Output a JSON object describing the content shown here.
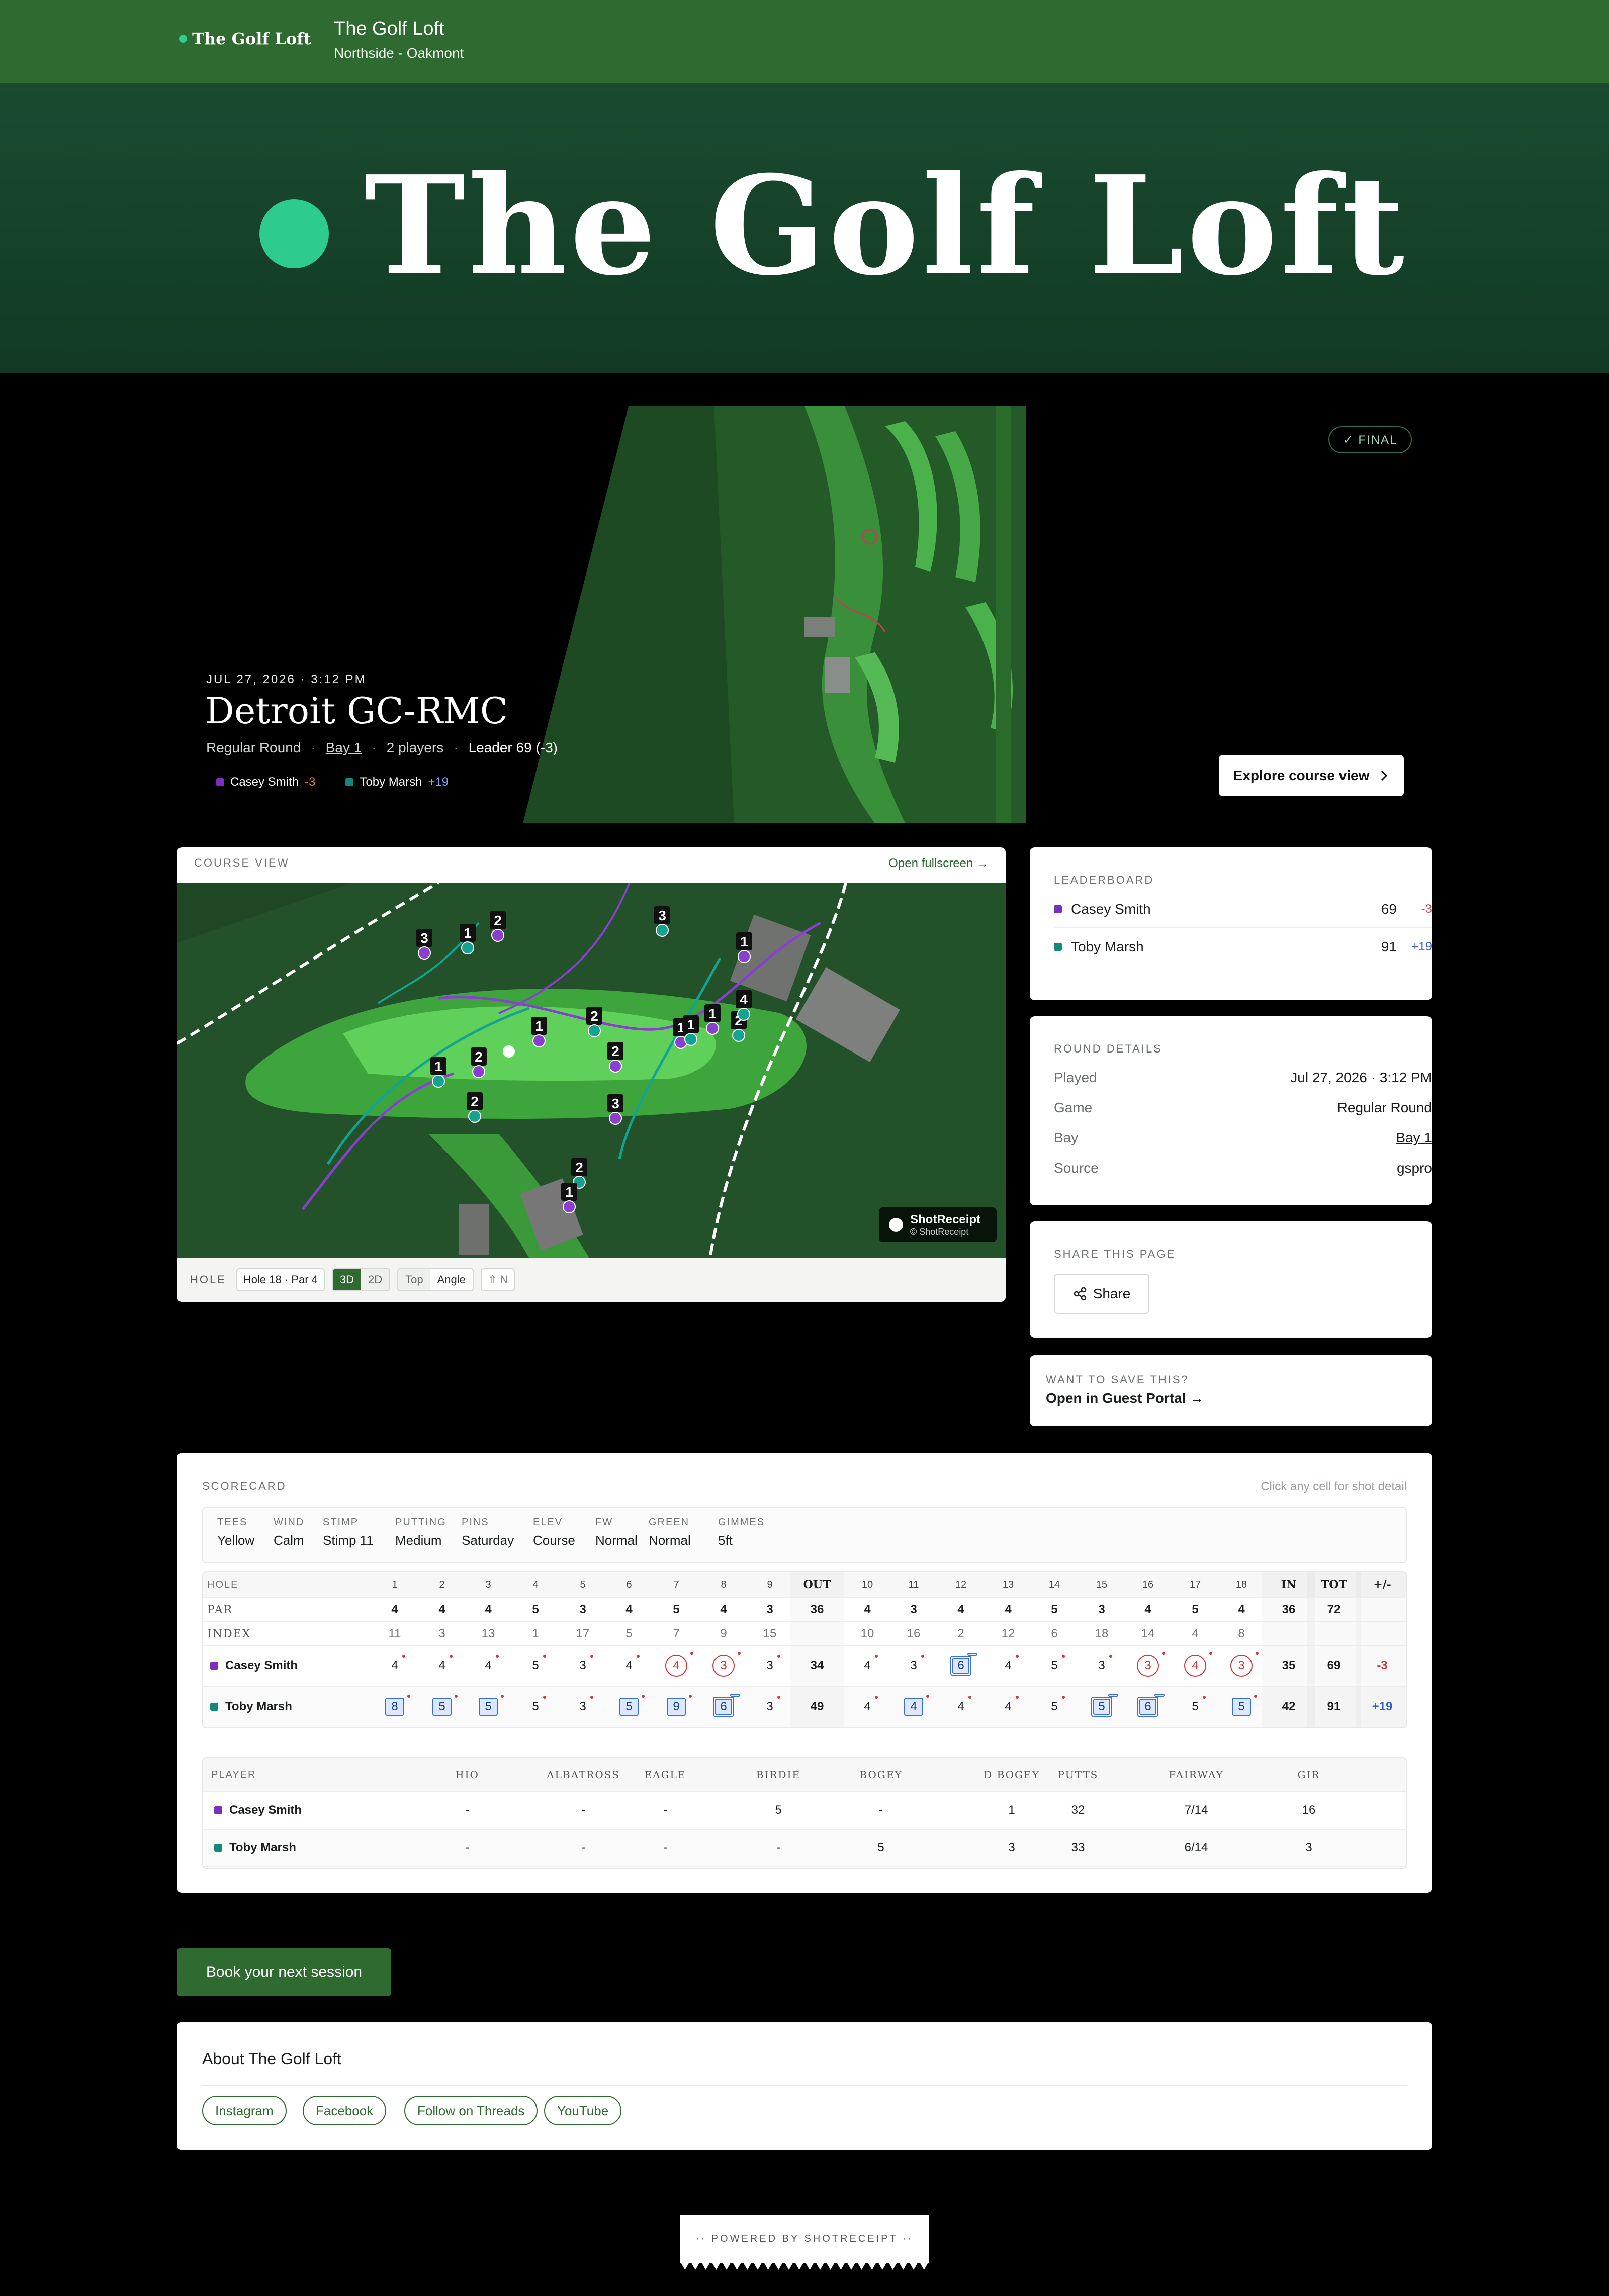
{
  "topbar": {
    "logo_text": "The Golf Loft",
    "venue_title": "The Golf Loft",
    "venue_location": "Northside - Oakmont",
    "accent_color": "#2fcb8f"
  },
  "banner": {
    "title": "The Golf Loft"
  },
  "hero": {
    "status_badge": "✓ FINAL",
    "date": "JUL 27, 2026 · 3:12 PM",
    "course": "Detroit GC-RMC",
    "game": "Regular Round",
    "bay": "Bay 1",
    "players_count": "2 players",
    "leader": "Leader 69 (-3)",
    "players": [
      {
        "name": "Casey Smith",
        "diff": "-3",
        "color": "#7b2fc1"
      },
      {
        "name": "Toby Marsh",
        "diff": "+19",
        "color": "#13897a"
      }
    ],
    "explore_label": "Explore course view",
    "separator": "·"
  },
  "course_view": {
    "label": "COURSE VIEW",
    "open_fullscreen": "Open fullscreen →",
    "brand_name": "ShotReceipt",
    "brand_copy": "© ShotReceipt",
    "hole_label": "HOLE",
    "hole_select": "Hole 18 · Par 4",
    "view_3d": "3D",
    "view_2d": "2D",
    "cam_top": "Top",
    "cam_angle": "Angle",
    "north": "⇧ N",
    "markers": [
      "3",
      "1",
      "2",
      "3",
      "1",
      "2",
      "1",
      "4",
      "1",
      "2",
      "2",
      "1",
      "2",
      "1",
      "1",
      "2",
      "3",
      "2",
      "1"
    ]
  },
  "leaderboard": {
    "label": "LEADERBOARD",
    "rows": [
      {
        "name": "Casey Smith",
        "score": "69",
        "diff": "-3"
      },
      {
        "name": "Toby Marsh",
        "score": "91",
        "diff": "+19"
      }
    ]
  },
  "round_details": {
    "label": "ROUND DETAILS",
    "rows": [
      {
        "k": "Played",
        "v": "Jul 27, 2026 · 3:12 PM"
      },
      {
        "k": "Game",
        "v": "Regular Round"
      },
      {
        "k": "Bay",
        "v": "Bay 1"
      },
      {
        "k": "Source",
        "v": "gspro"
      }
    ]
  },
  "share": {
    "label": "SHARE THIS PAGE",
    "button": "Share"
  },
  "guest": {
    "label": "WANT TO SAVE THIS?",
    "link": "Open in Guest Portal →"
  },
  "scorecard": {
    "label": "SCORECARD",
    "hint": "Click any cell for shot detail",
    "conditions": [
      {
        "k": "TEES",
        "v": "Yellow"
      },
      {
        "k": "WIND",
        "v": "Calm"
      },
      {
        "k": "STIMP",
        "v": "Stimp 11"
      },
      {
        "k": "PUTTING",
        "v": "Medium"
      },
      {
        "k": "PINS",
        "v": "Saturday"
      },
      {
        "k": "ELEV",
        "v": "Course"
      },
      {
        "k": "FW",
        "v": "Normal"
      },
      {
        "k": "GREEN",
        "v": "Normal"
      },
      {
        "k": "GIMMES",
        "v": "5ft"
      }
    ],
    "header": [
      "HOLE",
      "1",
      "2",
      "3",
      "4",
      "5",
      "6",
      "7",
      "8",
      "9",
      "OUT",
      "10",
      "11",
      "12",
      "13",
      "14",
      "15",
      "16",
      "17",
      "18",
      "IN",
      "TOT",
      "+/-"
    ],
    "par": [
      "PAR",
      "4",
      "4",
      "4",
      "5",
      "3",
      "4",
      "5",
      "4",
      "3",
      "36",
      "4",
      "3",
      "4",
      "4",
      "5",
      "3",
      "4",
      "5",
      "4",
      "36",
      "72",
      ""
    ],
    "index": [
      "INDEX",
      "11",
      "3",
      "13",
      "1",
      "17",
      "5",
      "7",
      "9",
      "15",
      "",
      "10",
      "16",
      "2",
      "12",
      "6",
      "18",
      "14",
      "4",
      "8",
      "",
      "",
      ""
    ],
    "players": [
      {
        "name": "Casey Smith",
        "scores": [
          "4",
          "4",
          "4",
          "5",
          "3",
          "4",
          "4",
          "3",
          "3",
          "34",
          "4",
          "3",
          "6",
          "4",
          "5",
          "3",
          "3",
          "4",
          "3",
          "35",
          "69",
          "-3"
        ],
        "marks": [
          "n",
          "n",
          "n",
          "n",
          "n",
          "n",
          "c",
          "c",
          "n",
          "t",
          "n",
          "n",
          "d",
          "n",
          "n",
          "n",
          "c",
          "c",
          "c",
          "t",
          "t",
          "t"
        ]
      },
      {
        "name": "Toby Marsh",
        "scores": [
          "8",
          "5",
          "5",
          "5",
          "3",
          "5",
          "9",
          "6",
          "3",
          "49",
          "4",
          "4",
          "4",
          "4",
          "5",
          "5",
          "6",
          "5",
          "5",
          "42",
          "91",
          "+19"
        ],
        "marks": [
          "b",
          "b",
          "b",
          "n",
          "n",
          "b",
          "b",
          "d",
          "n",
          "t",
          "n",
          "b",
          "n",
          "n",
          "n",
          "d",
          "d",
          "n",
          "b",
          "t",
          "t",
          "t"
        ]
      }
    ],
    "stats_header": [
      "PLAYER",
      "HIO",
      "ALBATROSS",
      "EAGLE",
      "BIRDIE",
      "BOGEY",
      "D BOGEY",
      "PUTTS",
      "FAIRWAY",
      "GIR"
    ],
    "stats": [
      {
        "name": "Casey Smith",
        "values": [
          "-",
          "-",
          "-",
          "5",
          "-",
          "1",
          "32",
          "7/14",
          "16"
        ]
      },
      {
        "name": "Toby Marsh",
        "values": [
          "-",
          "-",
          "-",
          "-",
          "5",
          "3",
          "33",
          "6/14",
          "3"
        ]
      }
    ]
  },
  "book_button": "Book your next session",
  "about": {
    "title": "About The Golf Loft",
    "links": [
      "Instagram",
      "Facebook",
      "Follow on Threads",
      "YouTube"
    ]
  },
  "footer": {
    "powered": "·· POWERED BY SHOTRECEIPT ··"
  }
}
